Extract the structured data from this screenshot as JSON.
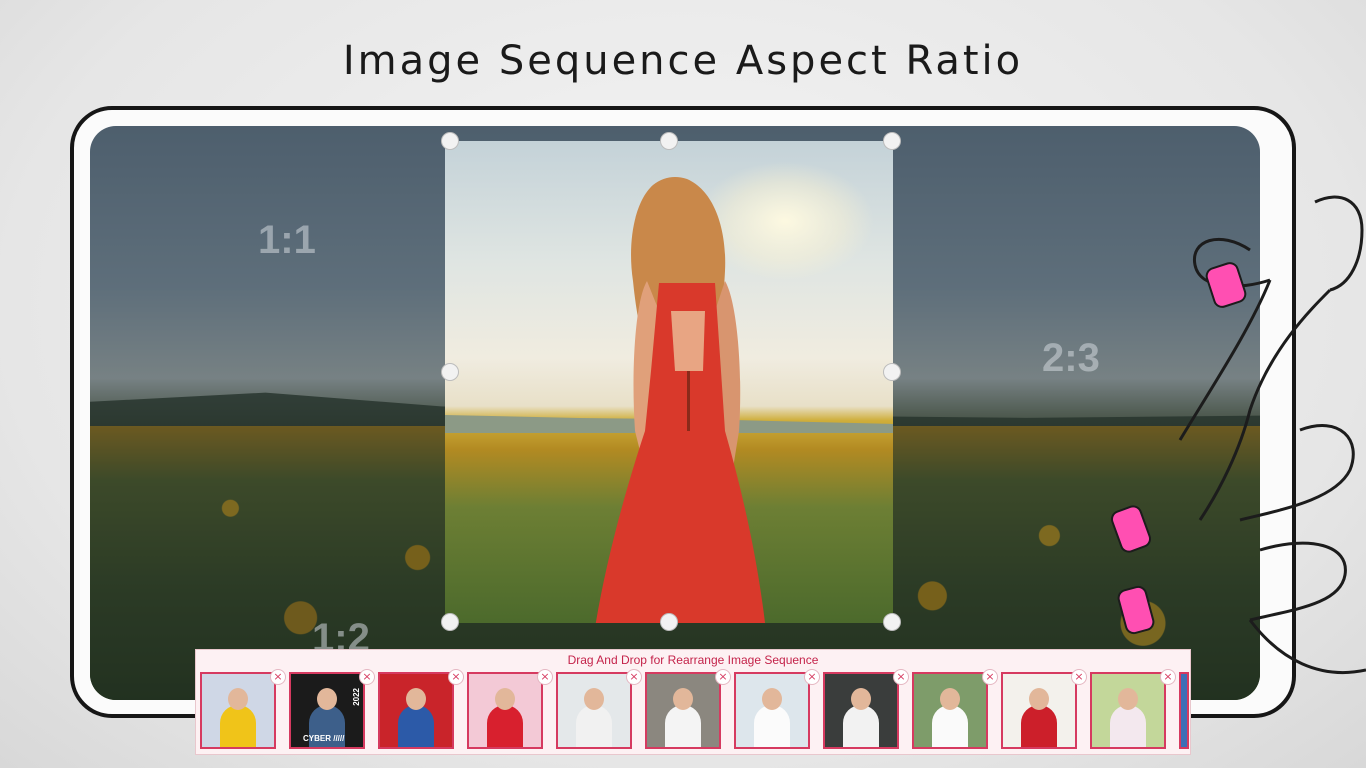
{
  "headline": "Image Sequence Aspect Ratio",
  "ratios": {
    "left": "1:1",
    "right": "2:3",
    "bottom": "1:2"
  },
  "strip": {
    "title": "Drag And Drop for Rearrange Image Sequence",
    "close_glyph": "×",
    "thumbnails": [
      {
        "label": "photo 1",
        "bg": "#cfd7e6",
        "dress": "#f0c419"
      },
      {
        "label": "photo 2",
        "bg": "#1b1b1b",
        "dress": "#3d5f8a",
        "caption": "CYBER /////",
        "year": "2022"
      },
      {
        "label": "photo 3",
        "bg": "#c9242a",
        "dress": "#2c5aa8"
      },
      {
        "label": "photo 4",
        "bg": "#f3c9d6",
        "dress": "#d8202e"
      },
      {
        "label": "photo 5",
        "bg": "#e4e8ea",
        "dress": "#f1f1f1"
      },
      {
        "label": "photo 6",
        "bg": "#8b877f",
        "dress": "#f4f4f4"
      },
      {
        "label": "photo 7",
        "bg": "#dde6ec",
        "dress": "#fbfbfb"
      },
      {
        "label": "photo 8",
        "bg": "#3a3d3c",
        "dress": "#f2f2f2"
      },
      {
        "label": "photo 9",
        "bg": "#7e9c6a",
        "dress": "#fafafa"
      },
      {
        "label": "photo 10",
        "bg": "#f3f1ec",
        "dress": "#cc1f2a"
      },
      {
        "label": "photo 11",
        "bg": "#c3d79a",
        "dress": "#f3e8ee"
      }
    ]
  },
  "colors": {
    "accent": "#d63a60",
    "nail": "#ff4fb2"
  }
}
